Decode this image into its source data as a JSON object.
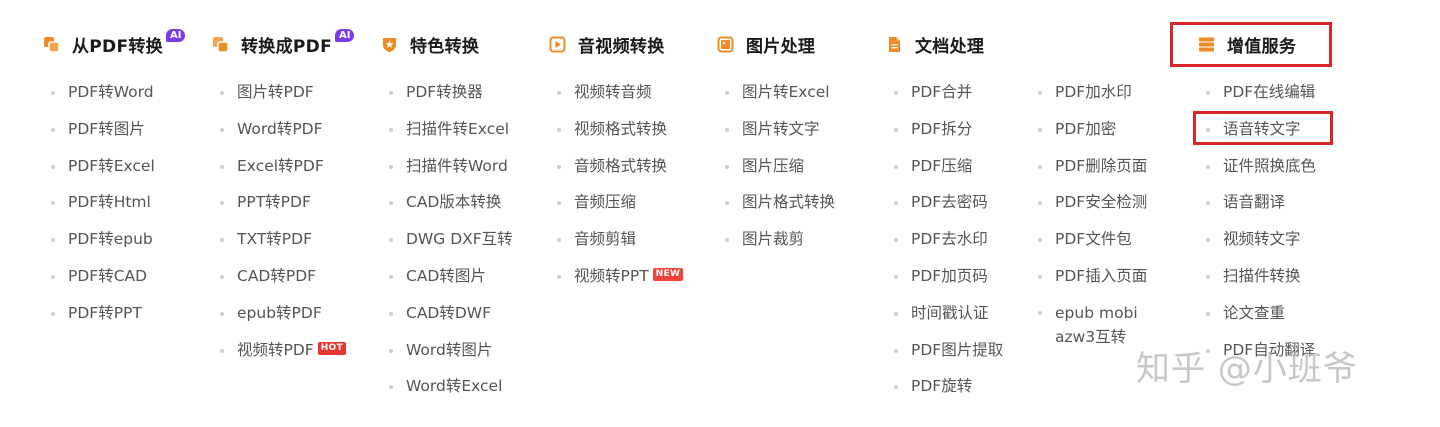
{
  "colors": {
    "accent": "#f08a24",
    "highlight_border": "#d9262b",
    "ai_badge": "#7c3aed",
    "hot_badge": "#e8372e"
  },
  "columns": [
    {
      "title": "从PDF转换",
      "badge": "AI",
      "icon": "pdf-convert-icon",
      "items": [
        "PDF转Word",
        "PDF转图片",
        "PDF转Excel",
        "PDF转Html",
        "PDF转epub",
        "PDF转CAD",
        "PDF转PPT"
      ]
    },
    {
      "title": "转换成PDF",
      "badge": "AI",
      "icon": "to-pdf-icon",
      "items": [
        "图片转PDF",
        "Word转PDF",
        "Excel转PDF",
        "PPT转PDF",
        "TXT转PDF",
        "CAD转PDF",
        "epub转PDF",
        "视频转PDF"
      ],
      "item_badge": "HOT"
    },
    {
      "title": "特色转换",
      "icon": "shield-star-icon",
      "items": [
        "PDF转换器",
        "扫描件转Excel",
        "扫描件转Word",
        "CAD版本转换",
        "DWG DXF互转",
        "CAD转图片",
        "CAD转DWF",
        "Word转图片",
        "Word转Excel"
      ]
    },
    {
      "title": "音视频转换",
      "icon": "video-icon",
      "items": [
        "视频转音频",
        "视频格式转换",
        "音频格式转换",
        "音频压缩",
        "音频剪辑",
        "视频转PPT"
      ],
      "item_badge": "NEW"
    },
    {
      "title": "图片处理",
      "icon": "image-icon",
      "items": [
        "图片转Excel",
        "图片转文字",
        "图片压缩",
        "图片格式转换",
        "图片裁剪"
      ]
    },
    {
      "title": "文档处理",
      "icon": "document-icon",
      "items": [
        "PDF合并",
        "PDF拆分",
        "PDF压缩",
        "PDF去密码",
        "PDF去水印",
        "PDF加页码",
        "时间戳认证",
        "PDF图片提取",
        "PDF旋转"
      ],
      "items_col2": [
        "PDF加水印",
        "PDF加密",
        "PDF删除页面",
        "PDF安全检测",
        "PDF文件包",
        "PDF插入页面",
        "epub mobi azw3互转"
      ]
    },
    {
      "title": "增值服务",
      "icon": "server-stack-icon",
      "items": [
        "PDF在线编辑",
        "语音转文字",
        "证件照换底色",
        "语音翻译",
        "视频转文字",
        "扫描件转换",
        "论文查重",
        "PDF自动翻译"
      ]
    }
  ],
  "watermark": "知乎 @小班爷"
}
